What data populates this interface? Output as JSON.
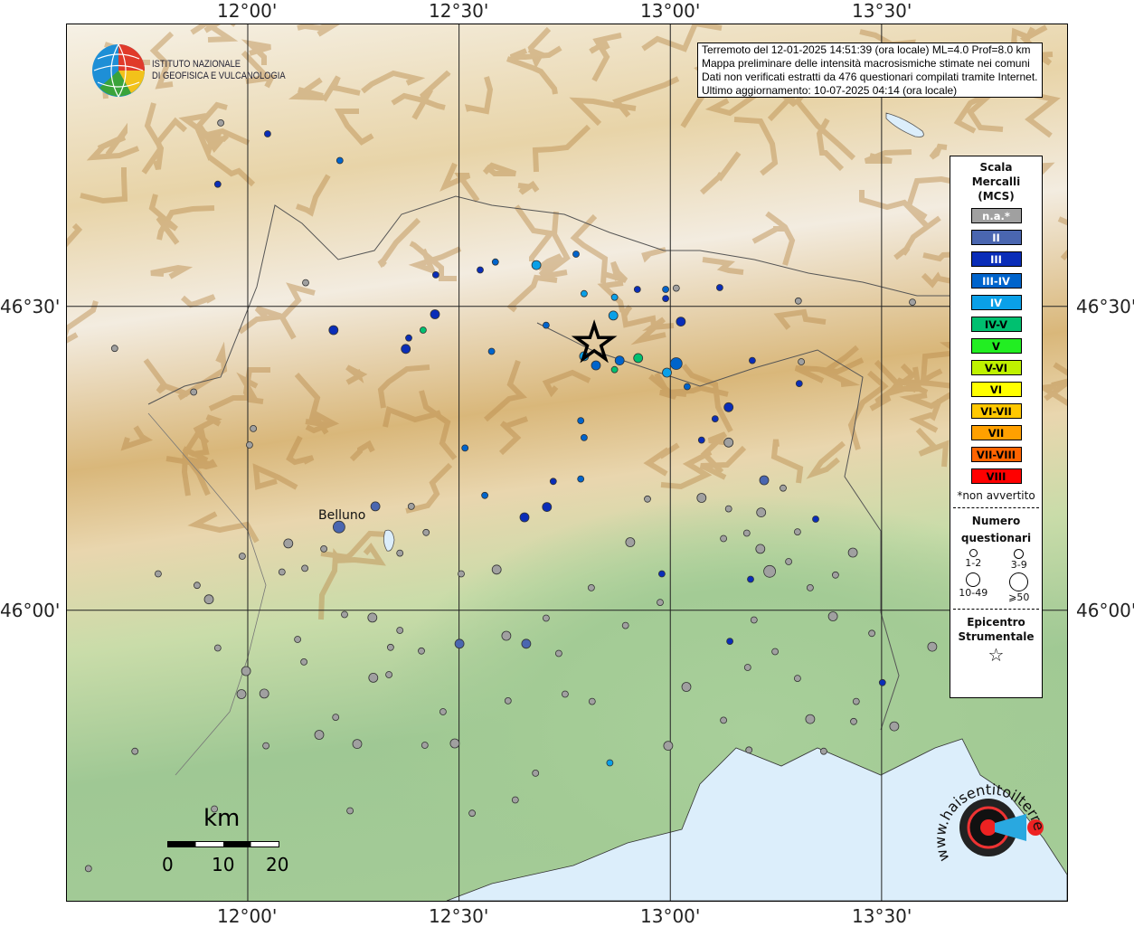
{
  "axes": {
    "lon_ticks": [
      "12°00'",
      "12°30'",
      "13°00'",
      "13°30'"
    ],
    "lat_ticks": [
      "46°30'",
      "46°00'"
    ],
    "lon_values": [
      12.0,
      12.5,
      13.0,
      13.5
    ],
    "lat_values": [
      46.5,
      46.0
    ],
    "extent": {
      "lon": [
        11.572,
        13.939
      ],
      "lat": [
        45.522,
        46.964
      ]
    }
  },
  "logo": {
    "line1": "ISTITUTO NAZIONALE",
    "line2": "DI GEOFISICA E VULCANOLOGIA"
  },
  "info": [
    "Terremoto del 12-01-2025 14:51:39 (ora locale) ML=4.0 Prof=8.0 km",
    "Mappa preliminare delle intensità macrosismiche stimate nei comuni",
    "Dati non verificati estratti da 476 questionari compilati tramite Internet.",
    "Ultimo aggiornamento: 10-07-2025 04:14 (ora locale)"
  ],
  "place_labels": {
    "belluno": "Belluno"
  },
  "scale": {
    "unit": "km",
    "ticks": [
      "0",
      "10",
      "20"
    ]
  },
  "legend": {
    "title": [
      "Scala",
      "Mercalli",
      "(MCS)"
    ],
    "classes": [
      {
        "label": "n.a.*",
        "color": "#a0a0a0",
        "text": "#ffffff"
      },
      {
        "label": "II",
        "color": "#4a66b0",
        "text": "#ffffff"
      },
      {
        "label": "III",
        "color": "#0a2db8",
        "text": "#ffffff"
      },
      {
        "label": "III-IV",
        "color": "#0064cc",
        "text": "#ffffff"
      },
      {
        "label": "IV",
        "color": "#0aa0e8",
        "text": "#ffffff"
      },
      {
        "label": "IV-V",
        "color": "#00c070",
        "text": "#000000"
      },
      {
        "label": "V",
        "color": "#22ee22",
        "text": "#000000"
      },
      {
        "label": "V-VI",
        "color": "#bff200",
        "text": "#000000"
      },
      {
        "label": "VI",
        "color": "#ffff00",
        "text": "#000000"
      },
      {
        "label": "VI-VII",
        "color": "#ffc800",
        "text": "#000000"
      },
      {
        "label": "VII",
        "color": "#ffa000",
        "text": "#000000"
      },
      {
        "label": "VII-VIII",
        "color": "#ff6400",
        "text": "#000000"
      },
      {
        "label": "VIII",
        "color": "#ff0000",
        "text": "#000000"
      }
    ],
    "note": "*non avvertito",
    "count_title": [
      "Numero",
      "questionari"
    ],
    "count_classes": [
      "1-2",
      "3-9",
      "10-49",
      "⩾50"
    ],
    "epicenter_title": [
      "Epicentro",
      "Strumentale"
    ]
  },
  "epicenter": {
    "lon": 12.82,
    "lat": 46.439,
    "symbol": "star-icon"
  },
  "watermark": "www.haisentitoilterremoto.it",
  "observations": [
    [
      11.936,
      46.802,
      "n.a.*",
      0
    ],
    [
      12.047,
      46.784,
      "III",
      0
    ],
    [
      12.218,
      46.74,
      "III-IV",
      0
    ],
    [
      11.929,
      46.701,
      "III",
      0
    ],
    [
      12.203,
      46.461,
      "III",
      1
    ],
    [
      12.374,
      46.43,
      "III",
      1
    ],
    [
      12.381,
      46.448,
      "III",
      0
    ],
    [
      12.415,
      46.461,
      "IV-V",
      0
    ],
    [
      12.443,
      46.487,
      "III",
      1
    ],
    [
      12.445,
      46.552,
      "III",
      0
    ],
    [
      12.55,
      46.56,
      "III",
      0
    ],
    [
      12.586,
      46.573,
      "III-IV",
      0
    ],
    [
      12.683,
      46.568,
      "IV",
      1
    ],
    [
      12.777,
      46.586,
      "III-IV",
      0
    ],
    [
      12.577,
      46.426,
      "III-IV",
      0
    ],
    [
      12.706,
      46.469,
      "III-IV",
      0
    ],
    [
      12.796,
      46.521,
      "IV",
      0
    ],
    [
      12.868,
      46.515,
      "IV",
      0
    ],
    [
      12.922,
      46.528,
      "III",
      0
    ],
    [
      12.989,
      46.528,
      "III-IV",
      0
    ],
    [
      12.989,
      46.513,
      "III",
      0
    ],
    [
      13.014,
      46.53,
      "n.a.*",
      0
    ],
    [
      13.117,
      46.531,
      "III",
      0
    ],
    [
      12.865,
      46.485,
      "IV",
      1
    ],
    [
      13.025,
      46.475,
      "III",
      1
    ],
    [
      12.796,
      46.418,
      "IV",
      1
    ],
    [
      12.824,
      46.403,
      "III-IV",
      1
    ],
    [
      12.88,
      46.411,
      "III-IV",
      1
    ],
    [
      12.924,
      46.415,
      "IV-V",
      1
    ],
    [
      12.868,
      46.396,
      "IV-V",
      0
    ],
    [
      13.014,
      46.406,
      "III-IV",
      2
    ],
    [
      12.992,
      46.391,
      "IV",
      1
    ],
    [
      13.04,
      46.368,
      "III-IV",
      0
    ],
    [
      13.194,
      46.411,
      "III",
      0
    ],
    [
      13.305,
      46.373,
      "III",
      0
    ],
    [
      13.138,
      46.334,
      "III",
      1
    ],
    [
      13.106,
      46.315,
      "III",
      0
    ],
    [
      13.074,
      46.28,
      "III",
      0
    ],
    [
      13.138,
      46.276,
      "n.a.*",
      1
    ],
    [
      12.788,
      46.312,
      "III-IV",
      0
    ],
    [
      12.796,
      46.284,
      "III-IV",
      0
    ],
    [
      12.514,
      46.267,
      "III-IV",
      0
    ],
    [
      12.723,
      46.212,
      "III",
      0
    ],
    [
      12.788,
      46.216,
      "III-IV",
      0
    ],
    [
      12.708,
      46.17,
      "III",
      1
    ],
    [
      12.655,
      46.153,
      "III",
      1
    ],
    [
      12.561,
      46.189,
      "III-IV",
      0
    ],
    [
      13.222,
      46.214,
      "II",
      1
    ],
    [
      13.344,
      46.15,
      "III",
      0
    ],
    [
      12.216,
      46.137,
      "II",
      2
    ],
    [
      12.302,
      46.171,
      "II",
      1
    ],
    [
      12.98,
      46.06,
      "III",
      0
    ],
    [
      13.19,
      46.051,
      "III",
      0
    ],
    [
      12.501,
      45.945,
      "II",
      1
    ],
    [
      12.659,
      45.945,
      "II",
      1
    ],
    [
      13.141,
      45.949,
      "III",
      0
    ],
    [
      13.502,
      45.881,
      "III",
      0
    ],
    [
      12.857,
      45.749,
      "IV",
      0
    ],
    [
      11.685,
      46.431,
      "n.a.*",
      0
    ],
    [
      11.872,
      46.359,
      "n.a.*",
      0
    ],
    [
      12.013,
      46.299,
      "n.a.*",
      0
    ],
    [
      12.004,
      46.272,
      "n.a.*",
      0
    ],
    [
      12.096,
      46.11,
      "n.a.*",
      1
    ],
    [
      11.908,
      46.018,
      "n.a.*",
      1
    ],
    [
      11.987,
      46.089,
      "n.a.*",
      0
    ],
    [
      11.996,
      45.9,
      "n.a.*",
      1
    ],
    [
      11.985,
      45.862,
      "n.a.*",
      1
    ],
    [
      12.039,
      45.863,
      "n.a.*",
      1
    ],
    [
      12.169,
      45.795,
      "n.a.*",
      1
    ],
    [
      12.259,
      45.78,
      "n.a.*",
      1
    ],
    [
      12.295,
      45.988,
      "n.a.*",
      1
    ],
    [
      12.297,
      45.889,
      "n.a.*",
      1
    ],
    [
      12.338,
      45.939,
      "n.a.*",
      0
    ],
    [
      12.411,
      45.933,
      "n.a.*",
      0
    ],
    [
      12.505,
      46.06,
      "n.a.*",
      0
    ],
    [
      12.589,
      46.067,
      "n.a.*",
      1
    ],
    [
      12.612,
      45.958,
      "n.a.*",
      1
    ],
    [
      12.706,
      45.987,
      "n.a.*",
      0
    ],
    [
      12.736,
      45.929,
      "n.a.*",
      0
    ],
    [
      12.751,
      45.862,
      "n.a.*",
      0
    ],
    [
      12.815,
      45.85,
      "n.a.*",
      0
    ],
    [
      12.49,
      45.781,
      "n.a.*",
      1
    ],
    [
      12.419,
      45.778,
      "n.a.*",
      0
    ],
    [
      12.681,
      45.732,
      "n.a.*",
      0
    ],
    [
      12.633,
      45.688,
      "n.a.*",
      0
    ],
    [
      12.531,
      45.666,
      "n.a.*",
      0
    ],
    [
      12.242,
      45.67,
      "n.a.*",
      0
    ],
    [
      11.921,
      45.673,
      "n.a.*",
      0
    ],
    [
      11.733,
      45.768,
      "n.a.*",
      0
    ],
    [
      11.623,
      45.575,
      "n.a.*",
      0
    ],
    [
      12.905,
      46.112,
      "n.a.*",
      1
    ],
    [
      12.946,
      46.183,
      "n.a.*",
      0
    ],
    [
      13.074,
      46.185,
      "n.a.*",
      1
    ],
    [
      13.138,
      46.167,
      "n.a.*",
      0
    ],
    [
      13.215,
      46.161,
      "n.a.*",
      1
    ],
    [
      13.267,
      46.201,
      "n.a.*",
      0
    ],
    [
      13.126,
      46.118,
      "n.a.*",
      0
    ],
    [
      13.181,
      46.127,
      "n.a.*",
      0
    ],
    [
      13.213,
      46.101,
      "n.a.*",
      1
    ],
    [
      13.235,
      46.064,
      "n.a.*",
      2
    ],
    [
      13.28,
      46.08,
      "n.a.*",
      0
    ],
    [
      13.432,
      46.095,
      "n.a.*",
      1
    ],
    [
      13.391,
      46.058,
      "n.a.*",
      0
    ],
    [
      13.331,
      46.037,
      "n.a.*",
      0
    ],
    [
      13.385,
      45.99,
      "n.a.*",
      1
    ],
    [
      13.198,
      45.984,
      "n.a.*",
      0
    ],
    [
      13.248,
      45.932,
      "n.a.*",
      0
    ],
    [
      13.183,
      45.906,
      "n.a.*",
      0
    ],
    [
      13.301,
      45.888,
      "n.a.*",
      0
    ],
    [
      13.331,
      45.821,
      "n.a.*",
      1
    ],
    [
      13.363,
      45.768,
      "n.a.*",
      0
    ],
    [
      13.434,
      45.817,
      "n.a.*",
      0
    ],
    [
      13.53,
      45.809,
      "n.a.*",
      1
    ],
    [
      13.62,
      45.94,
      "n.a.*",
      1
    ],
    [
      13.477,
      45.962,
      "n.a.*",
      0
    ],
    [
      12.995,
      45.777,
      "n.a.*",
      1
    ],
    [
      13.038,
      45.874,
      "n.a.*",
      1
    ],
    [
      13.126,
      45.819,
      "n.a.*",
      0
    ],
    [
      13.186,
      45.77,
      "n.a.*",
      0
    ],
    [
      12.894,
      45.975,
      "n.a.*",
      0
    ],
    [
      12.976,
      46.013,
      "n.a.*",
      0
    ],
    [
      12.813,
      46.037,
      "n.a.*",
      0
    ],
    [
      12.616,
      45.851,
      "n.a.*",
      0
    ],
    [
      12.462,
      45.833,
      "n.a.*",
      0
    ],
    [
      12.36,
      45.967,
      "n.a.*",
      0
    ],
    [
      12.334,
      45.894,
      "n.a.*",
      0
    ],
    [
      12.229,
      45.993,
      "n.a.*",
      0
    ],
    [
      12.118,
      45.952,
      "n.a.*",
      0
    ],
    [
      12.081,
      46.063,
      "n.a.*",
      0
    ],
    [
      12.135,
      46.069,
      "n.a.*",
      0
    ],
    [
      12.18,
      46.101,
      "n.a.*",
      0
    ],
    [
      12.36,
      46.094,
      "n.a.*",
      0
    ],
    [
      12.387,
      46.171,
      "n.a.*",
      0
    ],
    [
      12.422,
      46.128,
      "n.a.*",
      0
    ],
    [
      11.788,
      46.06,
      "n.a.*",
      0
    ],
    [
      11.88,
      46.041,
      "n.a.*",
      0
    ],
    [
      11.929,
      45.938,
      "n.a.*",
      0
    ],
    [
      12.043,
      45.777,
      "n.a.*",
      0
    ],
    [
      12.208,
      45.824,
      "n.a.*",
      0
    ],
    [
      12.133,
      45.915,
      "n.a.*",
      0
    ],
    [
      12.137,
      46.539,
      "n.a.*",
      0
    ],
    [
      13.31,
      46.409,
      "n.a.*",
      0
    ],
    [
      13.303,
      46.509,
      "n.a.*",
      0
    ],
    [
      13.573,
      46.507,
      "n.a.*",
      0
    ],
    [
      13.44,
      45.85,
      "n.a.*",
      0
    ],
    [
      13.301,
      46.129,
      "n.a.*",
      0
    ]
  ]
}
